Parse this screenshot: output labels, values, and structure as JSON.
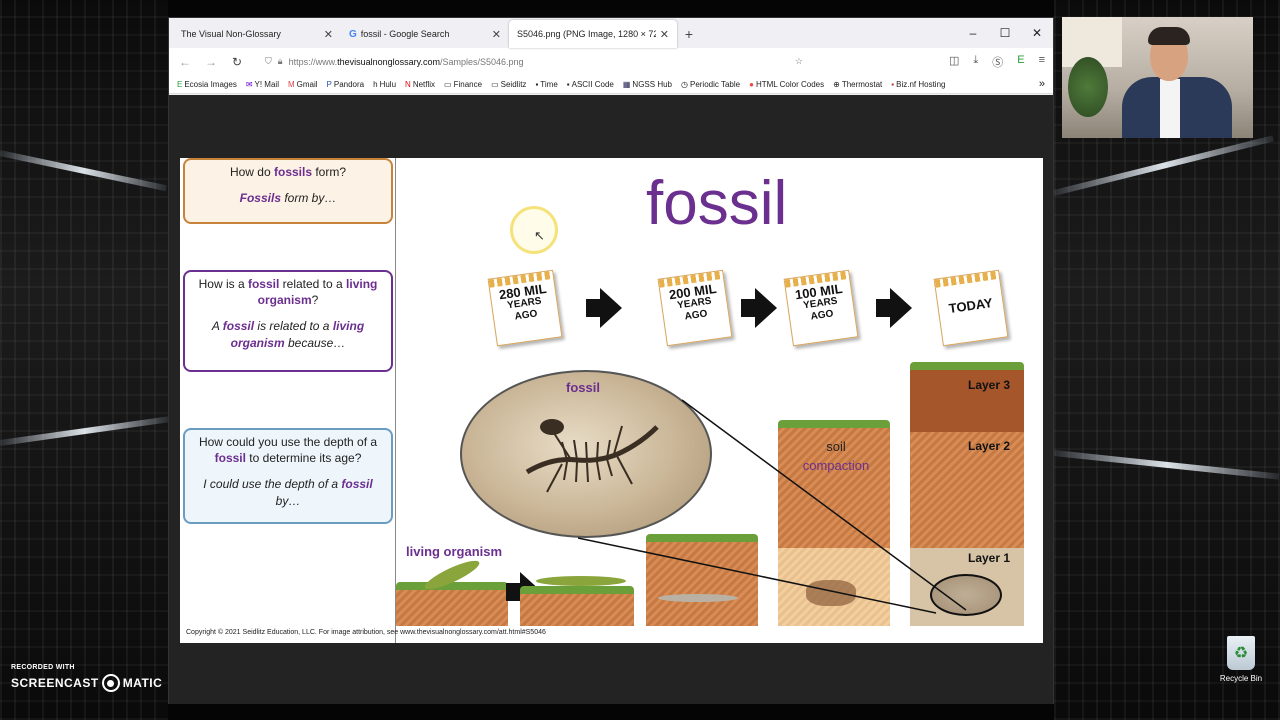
{
  "browser": {
    "tabs": [
      {
        "title": "The Visual Non-Glossary",
        "icon": "none"
      },
      {
        "title": "fossil - Google Search",
        "icon": "google-icon"
      },
      {
        "title": "S5046.png (PNG Image, 1280 × 720",
        "icon": "none"
      }
    ],
    "new_tab": "+",
    "window_controls": {
      "minimize": "–",
      "maximize": "☐",
      "close": "✕"
    },
    "url_prefix": "https://www.",
    "url_domain": "thevisualnonglossary.com",
    "url_path": "/Samples/S5046.png",
    "bookmarks": [
      "Ecosia Images",
      "Y! Mail",
      "Gmail",
      "Pandora",
      "Hulu",
      "Netflix",
      "Finance",
      "Seidlitz",
      "Time",
      "ASCII Code",
      "NGSS Hub",
      "Periodic Table",
      "HTML Color Codes",
      "Thermostat",
      "Biz.nf Hosting"
    ]
  },
  "slide": {
    "q1": {
      "q_pre": "How do ",
      "q_kw": "fossils",
      "q_post": " form?",
      "a_kw": "Fossils",
      "a_post": " form by…"
    },
    "q2": {
      "q_pre": "How is a ",
      "q_kw1": "fossil",
      "q_mid": " related to a ",
      "q_kw2": "living organism",
      "q_post": "?",
      "a_pre": "A ",
      "a_kw1": "fossil",
      "a_mid": " is related to a ",
      "a_kw2": "living organism",
      "a_post": " because…"
    },
    "q3": {
      "q_pre": "How could you use the depth of a ",
      "q_kw": "fossil",
      "q_post": " to determine its age?",
      "a_pre": "I could use the depth of a ",
      "a_kw": "fossil",
      "a_post": " by…"
    },
    "title": "fossil",
    "calendars": [
      {
        "big": "280 MIL",
        "line2": "YEARS",
        "line3": "AGO"
      },
      {
        "big": "200 MIL",
        "line2": "YEARS",
        "line3": "AGO"
      },
      {
        "big": "100 MIL",
        "line2": "YEARS",
        "line3": "AGO"
      },
      {
        "big": "TODAY",
        "line2": "",
        "line3": ""
      }
    ],
    "label_fossil": "fossil",
    "label_living": "living organism",
    "label_soil": "soil",
    "label_compaction": "compaction",
    "layers": [
      "Layer 3",
      "Layer 2",
      "Layer 1"
    ],
    "copyright": "Copyright © 2021 Seidlitz Education, LLC.   For image attribution, see www.thevisualnonglossary.com/att.html#S5046"
  },
  "overlay": {
    "recorded_with": "RECORDED WITH",
    "brand_left": "SCREENCAST",
    "brand_right": "MATIC",
    "recycle_bin": "Recycle Bin"
  },
  "colors": {
    "accent": "#6b2f8f",
    "orange_border": "#c8833a",
    "blue_border": "#6a9cc2"
  }
}
